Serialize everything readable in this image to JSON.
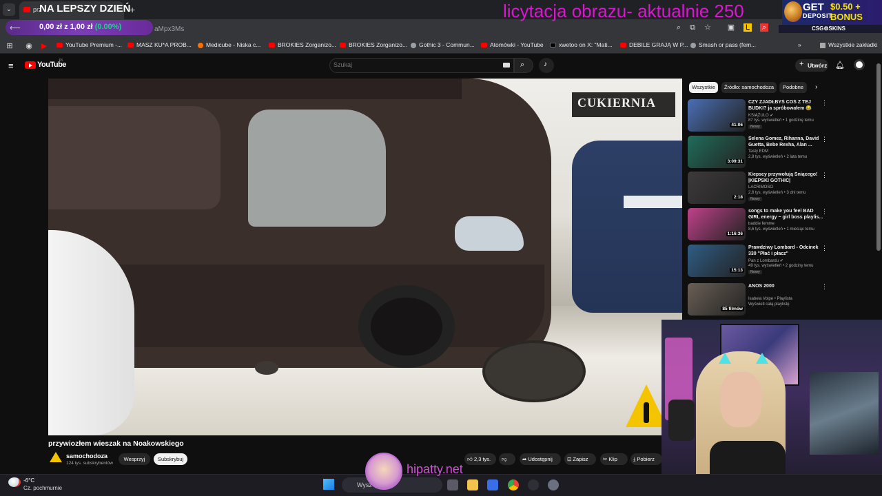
{
  "browser": {
    "tab_title": "prz",
    "url_tail": "aMpx3Ms",
    "bookmarks": [
      "YouTube Premium -...",
      "MASZ KU*A PROB...",
      "Medicube - Niska c...",
      "BROKIES Zorganizo...",
      "BROKIES Zorganizo...",
      "Gothic 3 - Commun...",
      "Atomówki - YouTube",
      "xwetoo on X: \"Mati...",
      "DEBILE GRAJĄ W P...",
      "Smash or pass (fem..."
    ],
    "all_bookmarks": "Wszystkie zakładki"
  },
  "overlay": {
    "stream_title": "NA LEPSZY DZIEŃ",
    "earnings": "0,00 zł z 1,00 zł",
    "earnings_pct": "(0.00%)",
    "auction": "licytacja obrazu-  aktualnie 250",
    "deposit_get": "GET",
    "deposit_amount": "$0.50 + BONUS",
    "deposit_sub": "DEPOSIT",
    "csg": "CSG⚙SKINS",
    "hipatty": "hipatty.net"
  },
  "youtube": {
    "logo": "YouTube",
    "country": "PL",
    "search_placeholder": "Szukaj",
    "create_label": "Utwórz",
    "video": {
      "sign_text": "CUKIERNIA",
      "title": "przywiozłem wieszak na Noakowskiego",
      "channel": "samochodoza",
      "subscribers": "124 tys. subskrybentów",
      "support": "Wesprzyj",
      "subscribe": "Subskrybuj",
      "likes": "2,3 tys.",
      "share": "Udostępnij",
      "save": "Zapisz",
      "clip": "Klip",
      "download": "Pobierz"
    },
    "chips": [
      "Wszystkie",
      "Źródło: samochodoza",
      "Podobne"
    ],
    "recommendations": [
      {
        "title": "CZY ZJADŁBYŚ COŚ Z TEJ BUDKI? ja spróbowałem 😂",
        "channel": "KSIĄŻULO ✔",
        "meta": "87 tys. wyświetleń • 1 godzinę temu",
        "badge": "Nowy",
        "duration": "41:06",
        "color": "#4a6fb5"
      },
      {
        "title": "Selena Gomez, Rihanna, David Guetta, Bebe Rexha, Alan ...",
        "channel": "Tasty EDM",
        "meta": "2,8 tys. wyświetleń • 2 lata temu",
        "badge": "",
        "duration": "3:09:31",
        "color": "#1f6d5a"
      },
      {
        "title": "Kiepscy przywołują Śniącego! |KIEPSKI GOTHIC|",
        "channel": "LACRIMOSO",
        "meta": "2,6 tys. wyświetleń • 3 dni temu",
        "badge": "Nowy",
        "duration": "2:18",
        "color": "#3d3a3a"
      },
      {
        "title": "songs to make you feel BAD GIRL energy ~ girl boss playlis...",
        "channel": "baddie femme",
        "meta": "8,6 tys. wyświetleń • 1 miesiąc temu",
        "badge": "",
        "duration": "1:16:36",
        "color": "#c0418a"
      },
      {
        "title": "Prawdziwy Lombard - Odcinek 330 \"Płać i płacz\"",
        "channel": "Pan z Lombardu ✔",
        "meta": "49 tys. wyświetleń • 2 godziny temu",
        "badge": "Nowy",
        "duration": "15:13",
        "color": "#2f5d86"
      },
      {
        "title": "ANOS 2000",
        "channel": "Isabela Volpe • Playlista",
        "meta": "Wyświetl całą playlistę",
        "badge": "",
        "duration": "85 filmów",
        "color": "#6a5f56"
      }
    ]
  },
  "taskbar": {
    "temperature": "-6°C",
    "weather": "Cz. pochmurnie",
    "search": "Wysz"
  }
}
